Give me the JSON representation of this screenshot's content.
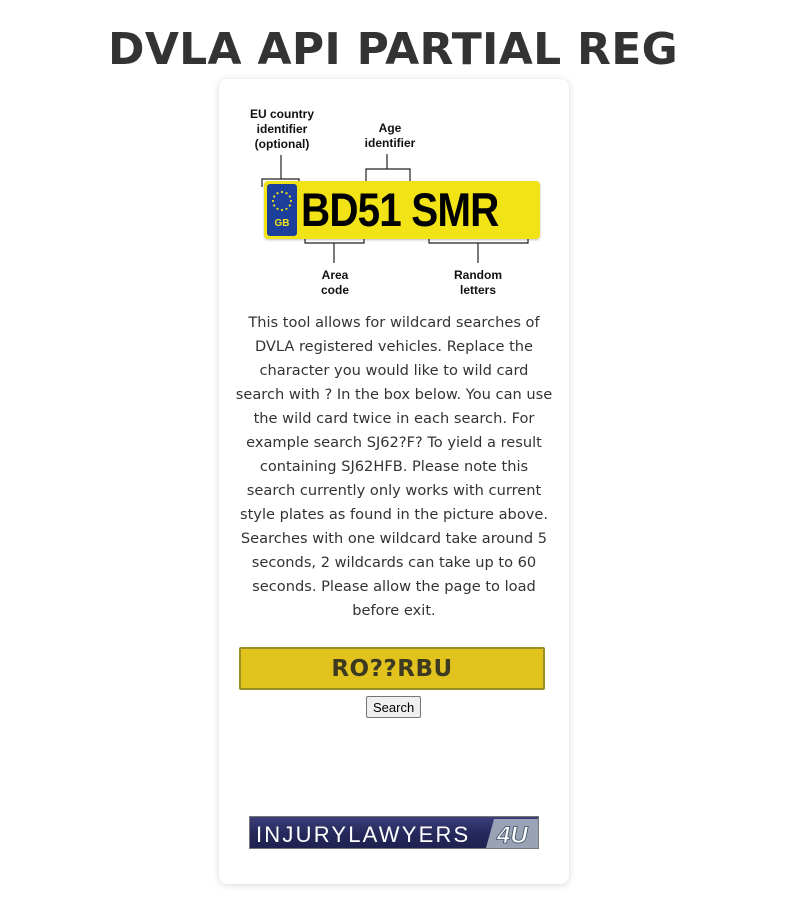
{
  "page": {
    "title": "DVLA API PARTIAL REG SEARCH"
  },
  "diagram": {
    "eu_label_line1": "EU country",
    "eu_label_line2": "identifier",
    "eu_label_line3": "(optional)",
    "age_label_line1": "Age",
    "age_label_line2": "identifier",
    "area_label_line1": "Area",
    "area_label_line2": "code",
    "random_label_line1": "Random",
    "random_label_line2": "letters",
    "country_code": "GB",
    "plate_text": "BD51 SMR"
  },
  "description": {
    "paragraph1": "This tool allows for wildcard searches of DVLA registered vehicles. Replace the character you would like to wild card search with ? In the box below. You can use the wild card twice in each search. For example search SJ62?F? To yield a result containing SJ62HFB. Please note this search currently only works with current style plates as found in the picture above.",
    "paragraph2": "Searches with one wildcard take around 5 seconds, 2 wildcards can take up to 60 seconds. Please allow the page to load before exit."
  },
  "search": {
    "input_value": "RO??RBU",
    "button_label": "Search"
  },
  "logo": {
    "text_main": "INJURYLAWYERS",
    "text_suffix": "4U"
  },
  "colors": {
    "plate_yellow": "#f1e315",
    "input_yellow": "#e2c21d",
    "eu_blue": "#1b3f9a",
    "logo_navy": "#25285a",
    "text": "#333333"
  }
}
